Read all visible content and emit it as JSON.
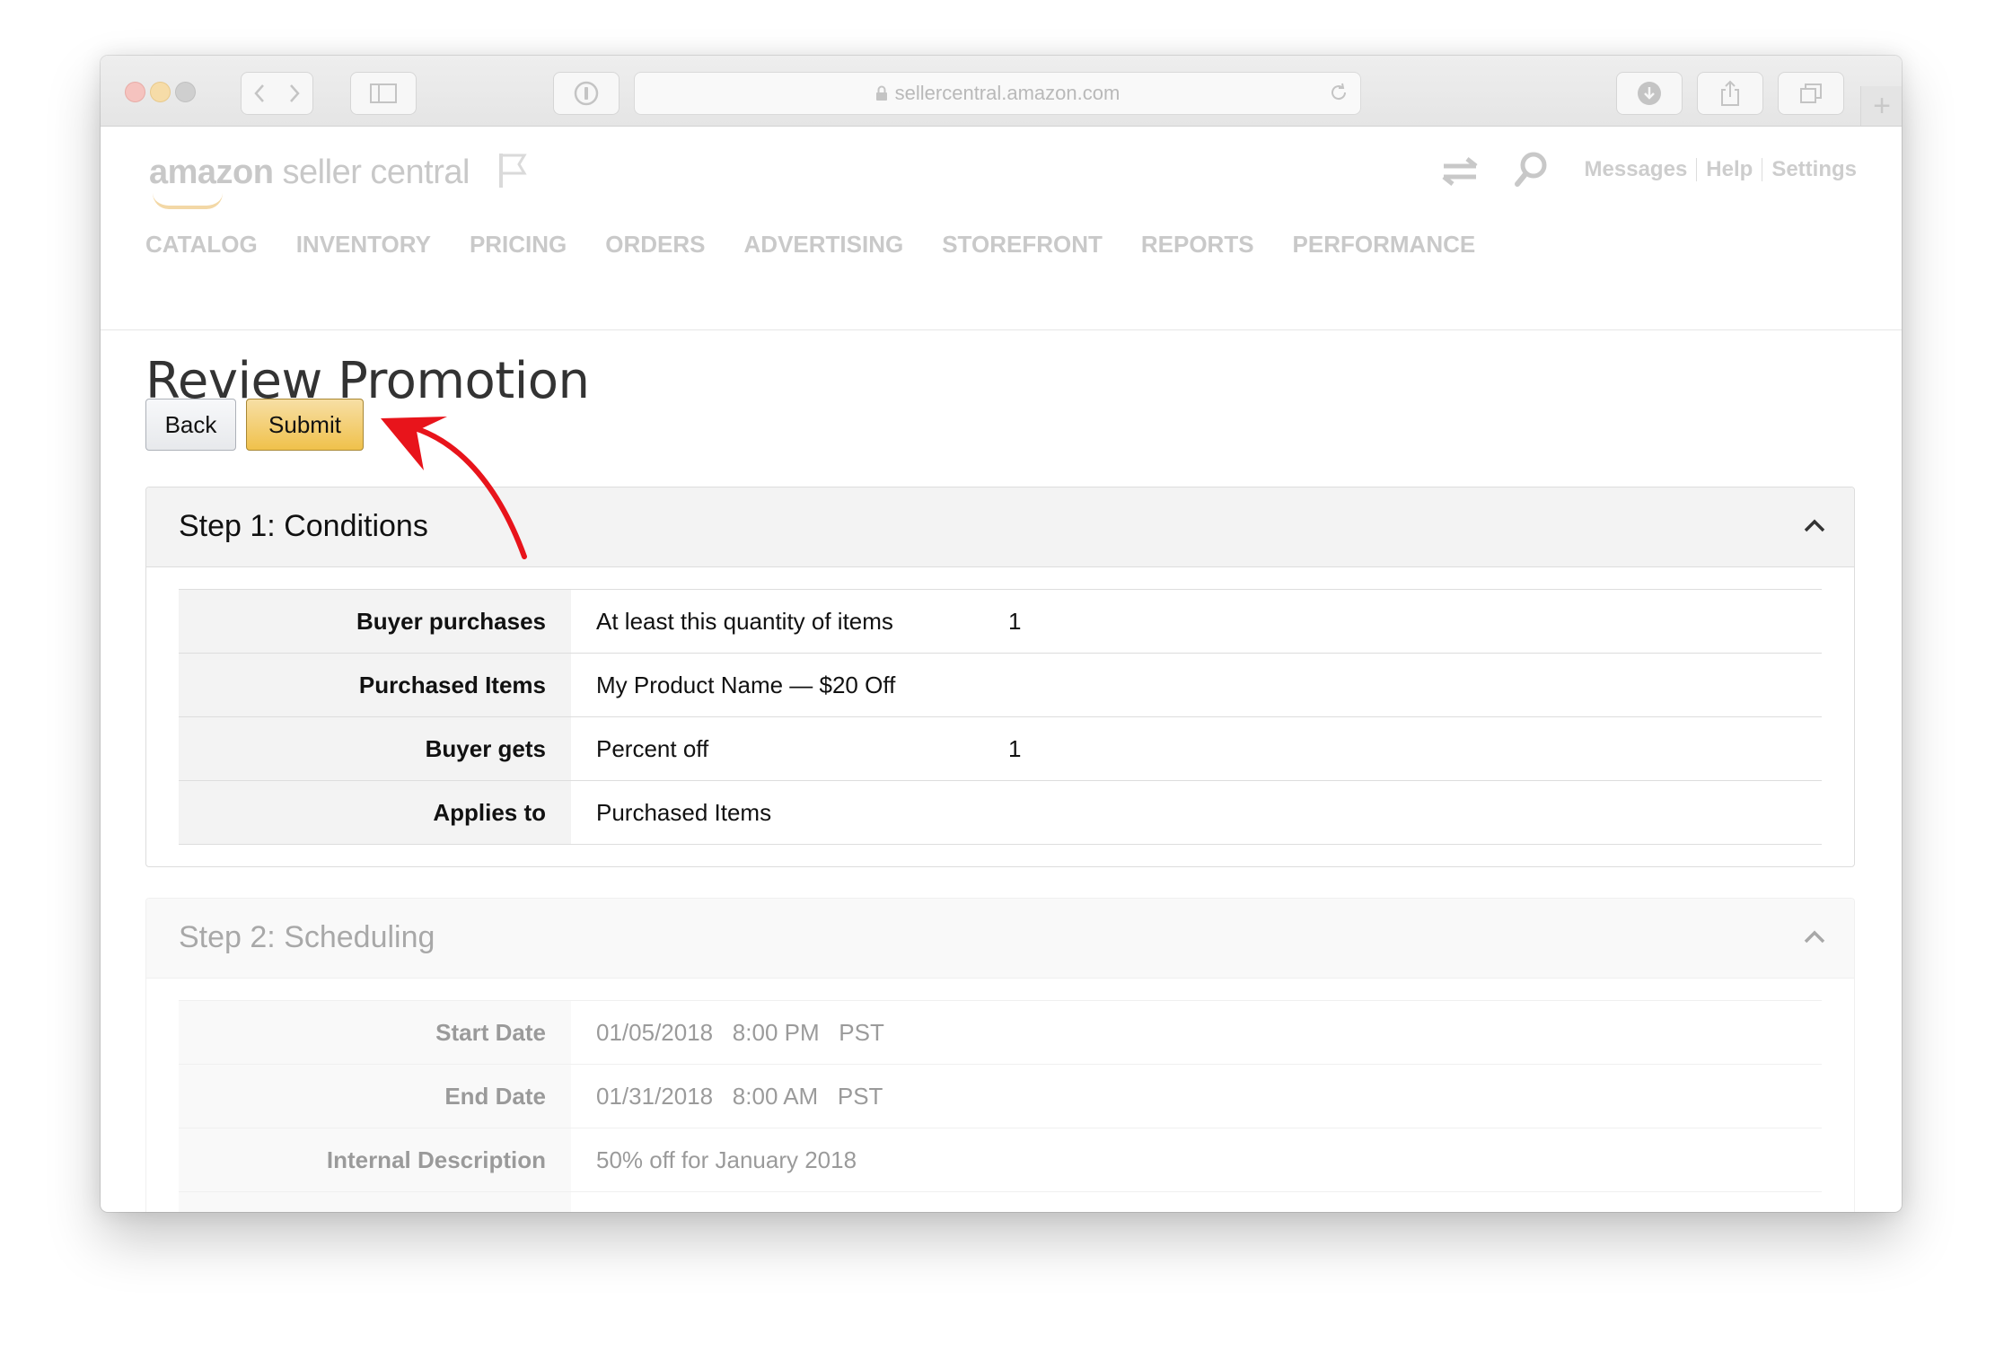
{
  "browser": {
    "url": "sellercentral.amazon.com",
    "new_tab_symbol": "+"
  },
  "header": {
    "logo_brand": "amazon",
    "logo_product": "seller central",
    "links": [
      "Messages",
      "Help",
      "Settings"
    ]
  },
  "nav": {
    "items": [
      "CATALOG",
      "INVENTORY",
      "PRICING",
      "ORDERS",
      "ADVERTISING",
      "STOREFRONT",
      "REPORTS",
      "PERFORMANCE"
    ]
  },
  "page": {
    "title": "Review Promotion",
    "back_label": "Back",
    "submit_label": "Submit"
  },
  "step1": {
    "title": "Step 1: Conditions",
    "rows": [
      {
        "label": "Buyer purchases",
        "value": "At least this quantity of items",
        "extra": "1"
      },
      {
        "label": "Purchased Items",
        "value": "My Product Name — $20 Off",
        "extra": ""
      },
      {
        "label": "Buyer gets",
        "value": "Percent off",
        "extra": "1"
      },
      {
        "label": "Applies to",
        "value": "Purchased Items",
        "extra": ""
      }
    ]
  },
  "step2": {
    "title": "Step 2: Scheduling",
    "rows": [
      {
        "label": "Start Date",
        "value": "01/05/2018   8:00 PM   PST"
      },
      {
        "label": "End Date",
        "value": "01/31/2018   8:00 AM   PST"
      },
      {
        "label": "Internal Description",
        "value": "50% off for January 2018"
      }
    ]
  },
  "colors": {
    "submit": "#f0c14b",
    "annotation_arrow": "#e8141b"
  }
}
